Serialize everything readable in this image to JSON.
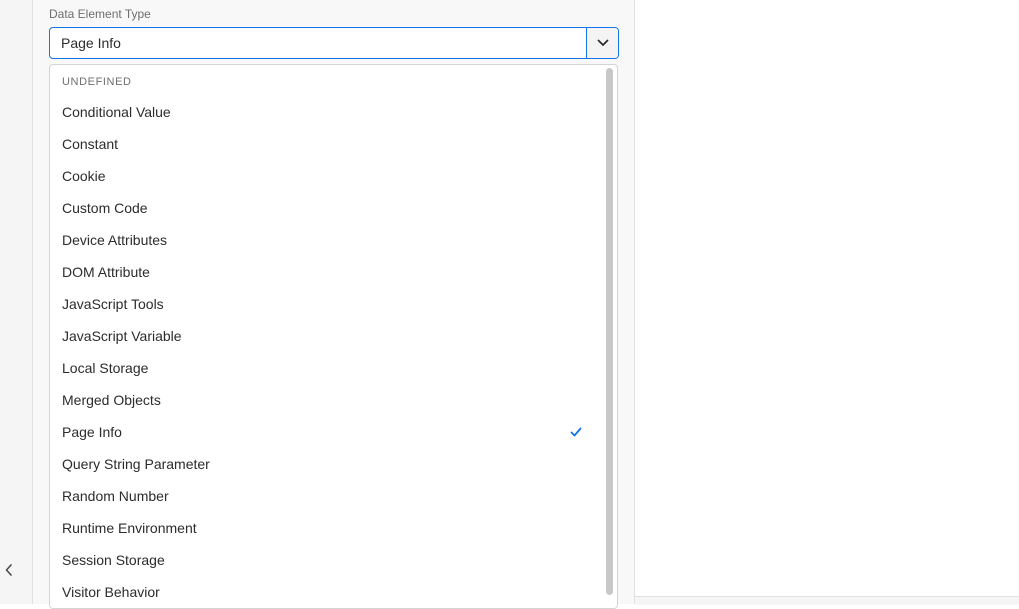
{
  "field": {
    "label": "Data Element Type",
    "value": "Page Info"
  },
  "dropdown": {
    "section_header": "UNDEFINED",
    "selected": "Page Info",
    "options": [
      {
        "label": "Conditional Value"
      },
      {
        "label": "Constant"
      },
      {
        "label": "Cookie"
      },
      {
        "label": "Custom Code"
      },
      {
        "label": "Device Attributes"
      },
      {
        "label": "DOM Attribute"
      },
      {
        "label": "JavaScript Tools"
      },
      {
        "label": "JavaScript Variable"
      },
      {
        "label": "Local Storage"
      },
      {
        "label": "Merged Objects"
      },
      {
        "label": "Page Info"
      },
      {
        "label": "Query String Parameter"
      },
      {
        "label": "Random Number"
      },
      {
        "label": "Runtime Environment"
      },
      {
        "label": "Session Storage"
      },
      {
        "label": "Visitor Behavior"
      }
    ]
  },
  "icons": {
    "dropdown_toggle": "chevron-down-icon",
    "selected_marker": "checkmark-icon",
    "collapse": "chevron-left-icon"
  },
  "colors": {
    "accent": "#1473e6",
    "text": "#2c2c2c",
    "muted": "#6e6e6e"
  }
}
